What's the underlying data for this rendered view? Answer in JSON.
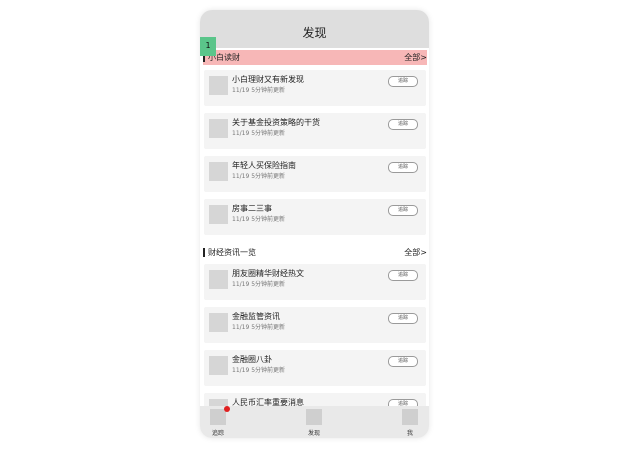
{
  "header": {
    "title": "发现"
  },
  "badge": {
    "label": "1"
  },
  "sections": [
    {
      "title": "小白读财",
      "all_label": "全部>",
      "items": [
        {
          "name": "小白理财又有新发现",
          "date": "11/19",
          "updated": "5分钟前更新",
          "button": "追踪"
        },
        {
          "name": "关于基金投资策略的干货",
          "date": "11/19",
          "updated": "5分钟前更新",
          "button": "追踪"
        },
        {
          "name": "年轻人买保险指南",
          "date": "11/19",
          "updated": "5分钟前更新",
          "button": "追踪"
        },
        {
          "name": "房事二三事",
          "date": "11/19",
          "updated": "5分钟前更新",
          "button": "追踪"
        }
      ]
    },
    {
      "title": "财经资讯一览",
      "all_label": "全部>",
      "items": [
        {
          "name": "朋友圈精华财经热文",
          "date": "11/19",
          "updated": "5分钟前更新",
          "button": "追踪"
        },
        {
          "name": "金融监管资讯",
          "date": "11/19",
          "updated": "5分钟前更新",
          "button": "追踪"
        },
        {
          "name": "金融圈八卦",
          "date": "11/19",
          "updated": "5分钟前更新",
          "button": "追踪"
        },
        {
          "name": "人民币汇率重要消息",
          "date": "",
          "updated": "",
          "button": "追踪"
        }
      ]
    }
  ],
  "tabbar": {
    "items": [
      {
        "label": "追踪",
        "icon": "track-icon"
      },
      {
        "label": "发现",
        "icon": "discover-icon"
      },
      {
        "label": "我",
        "icon": "profile-icon"
      }
    ]
  },
  "colors": {
    "highlight": "#f7b7b7",
    "badge": "#5ac58a",
    "notification_dot": "#e02020"
  }
}
